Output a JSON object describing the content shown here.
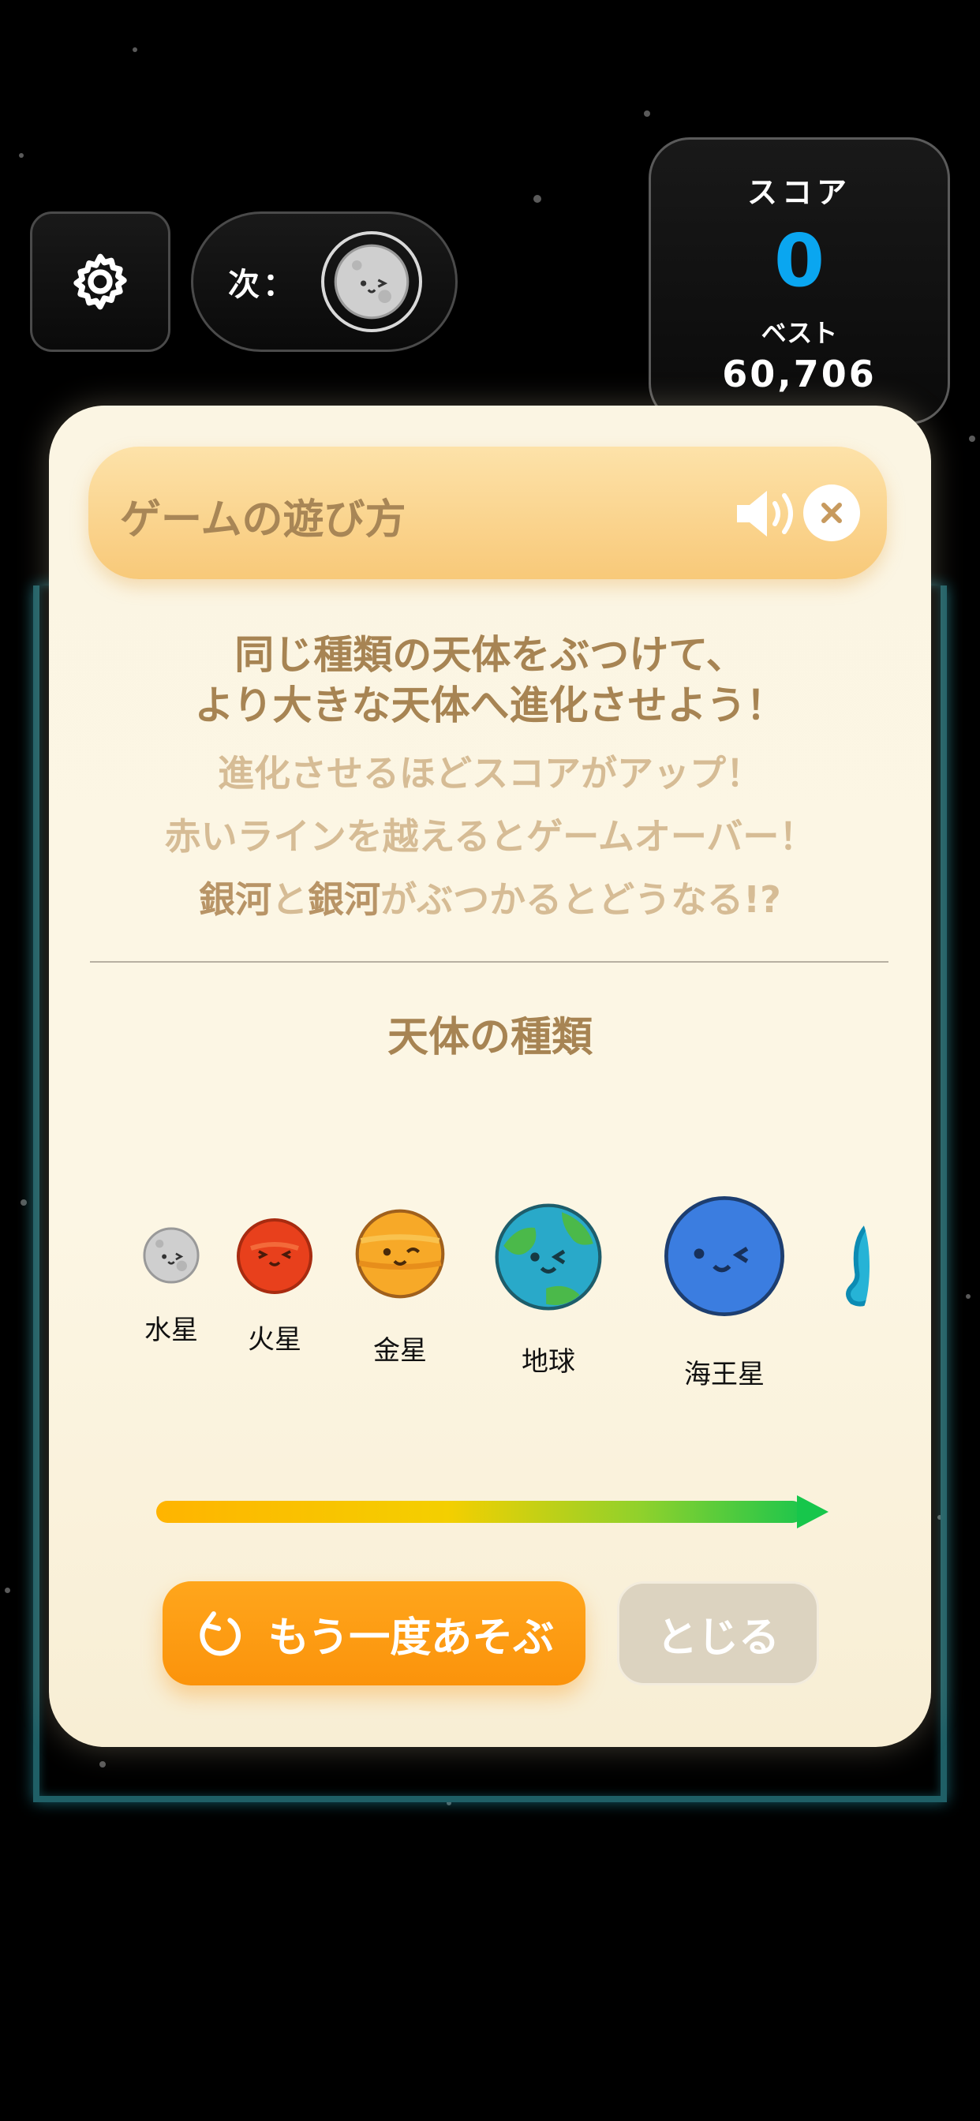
{
  "hud": {
    "next_label": "次：",
    "score_title": "スコア",
    "score_value": "0",
    "best_title": "ベスト",
    "best_value": "60,706"
  },
  "modal": {
    "title": "ゲームの遊び方",
    "desc_line1": "同じ種類の天体をぶつけて、",
    "desc_line2": "より大きな天体へ進化させよう！",
    "desc_line3": "進化させるほどスコアがアップ！",
    "desc_line4": "赤いラインを越えるとゲームオーバー！",
    "desc_line5_a": "銀河",
    "desc_line5_b": "と",
    "desc_line5_c": "銀河",
    "desc_line5_d": "がぶつかるとどうなる!?",
    "section_title": "天体の種類",
    "planets": [
      {
        "label": "水星",
        "color": "#c9c9c9"
      },
      {
        "label": "火星",
        "color": "#e8401c"
      },
      {
        "label": "金星",
        "color": "#f7a928"
      },
      {
        "label": "地球",
        "color": "#29a9c9"
      },
      {
        "label": "海王星",
        "color": "#3b7de0"
      }
    ],
    "replay_label": "もう一度あそぶ",
    "close_label": "とじる"
  },
  "colors": {
    "score_accent": "#0aa6f0",
    "replay_orange": "#fb930b",
    "modal_bg": "#fbf5e3"
  },
  "icons": [
    "gear-icon",
    "sound-icon",
    "close-icon",
    "replay-icon",
    "mercury-next-icon"
  ]
}
